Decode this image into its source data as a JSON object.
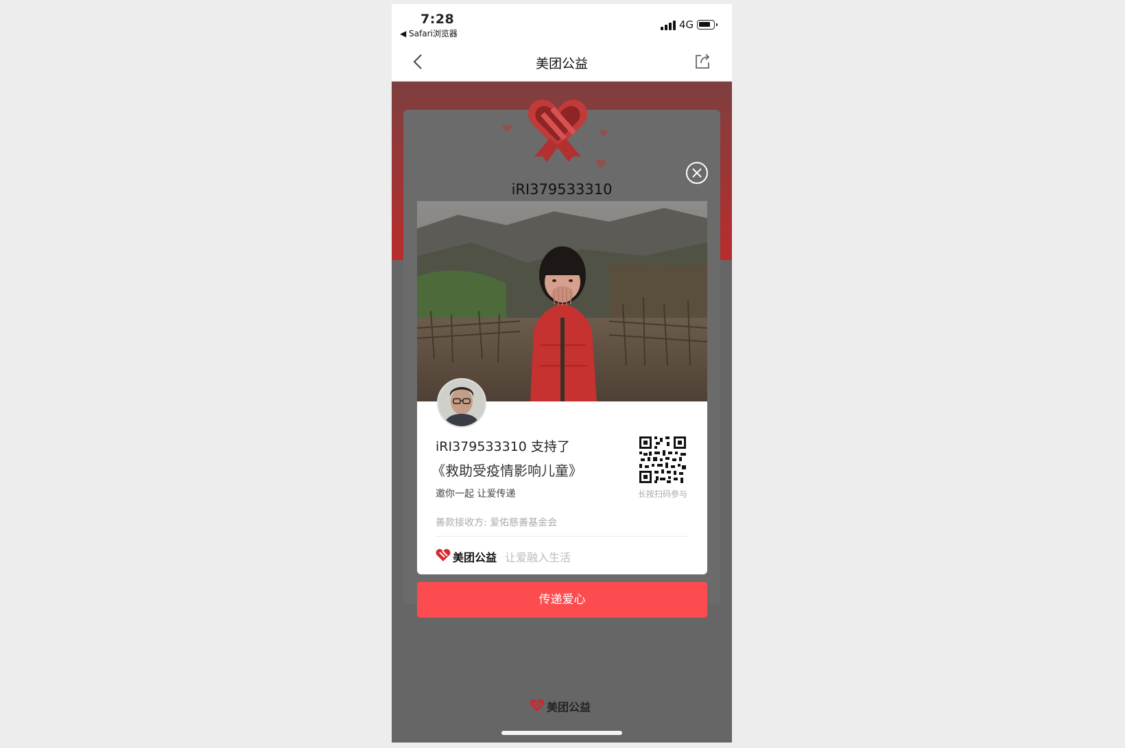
{
  "status_bar": {
    "time": "7:28",
    "back_app": "◀ Safari浏览器",
    "network": "4G"
  },
  "nav": {
    "title": "美团公益"
  },
  "card": {
    "username_top": "iRI379533310",
    "support_text": "iRI379533310 支持了",
    "project_name": "《救助受疫情影响儿童》",
    "invite_text": "邀你一起 让爱传递",
    "qr_label": "长按扫码参与",
    "receiver": "善款接收方:  爱佑慈善基金会",
    "brand_name": "美团公益",
    "brand_slogan": "让爱融入生活"
  },
  "cta_label": "传递爱心",
  "footer_brand": "美团公益",
  "colors": {
    "accent": "#fd4c4f",
    "brand_red": "#d8282d",
    "band_top": "#7e3f3f",
    "band_bottom": "#b92c2c"
  }
}
